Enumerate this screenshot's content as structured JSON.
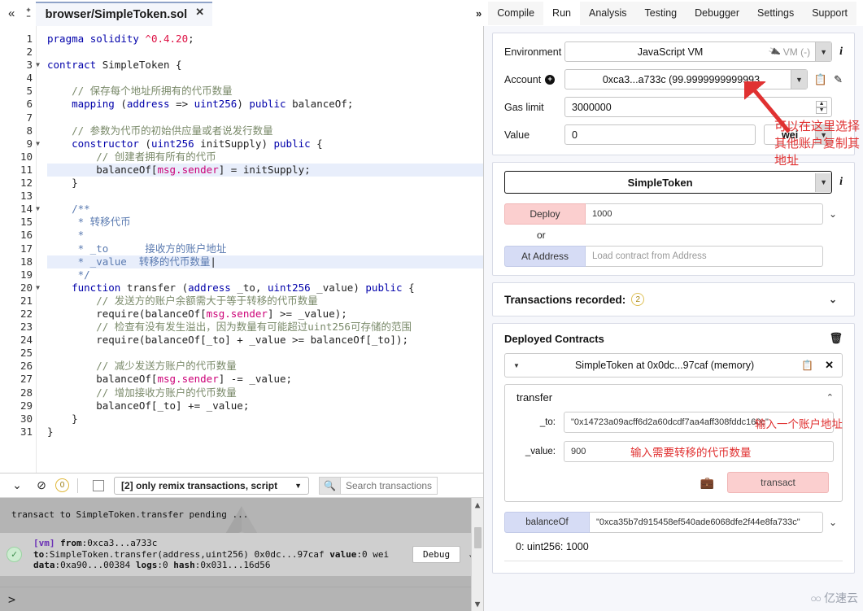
{
  "window": {
    "file_tab": "browser/SimpleToken.sol",
    "collapse_icon": "chevrons-left-icon",
    "zoom_in_icon": "plus-icon",
    "zoom_out_icon": "minus-icon",
    "tab_close_icon": "close-icon"
  },
  "menu": {
    "expand_icon": "chevrons-right-icon",
    "tabs": [
      {
        "label": "Compile",
        "active": false
      },
      {
        "label": "Run",
        "active": true
      },
      {
        "label": "Analysis",
        "active": false
      },
      {
        "label": "Testing",
        "active": false
      },
      {
        "label": "Debugger",
        "active": false
      },
      {
        "label": "Settings",
        "active": false
      },
      {
        "label": "Support",
        "active": false
      }
    ]
  },
  "editor": {
    "lines": [
      {
        "n": 1,
        "fold": false,
        "hl": false,
        "tokens": [
          {
            "t": "pragma ",
            "c": "k"
          },
          {
            "t": "solidity ",
            "c": "k"
          },
          {
            "t": "^0.4.20",
            "c": "num"
          },
          {
            "t": ";",
            "c": "pl"
          }
        ]
      },
      {
        "n": 2,
        "fold": false,
        "hl": false,
        "tokens": []
      },
      {
        "n": 3,
        "fold": true,
        "hl": false,
        "tokens": [
          {
            "t": "contract ",
            "c": "k"
          },
          {
            "t": "SimpleToken ",
            "c": "pl"
          },
          {
            "t": "{",
            "c": "pl"
          }
        ]
      },
      {
        "n": 4,
        "fold": false,
        "hl": false,
        "tokens": []
      },
      {
        "n": 5,
        "fold": false,
        "hl": false,
        "tokens": [
          {
            "t": "    // 保存每个地址所拥有的代币数量",
            "c": "cm"
          }
        ]
      },
      {
        "n": 6,
        "fold": false,
        "hl": false,
        "tokens": [
          {
            "t": "    ",
            "c": "pl"
          },
          {
            "t": "mapping",
            "c": "k"
          },
          {
            "t": " (",
            "c": "pl"
          },
          {
            "t": "address",
            "c": "k"
          },
          {
            "t": " => ",
            "c": "pl"
          },
          {
            "t": "uint256",
            "c": "k"
          },
          {
            "t": ") ",
            "c": "pl"
          },
          {
            "t": "public",
            "c": "k"
          },
          {
            "t": " balanceOf;",
            "c": "pl"
          }
        ]
      },
      {
        "n": 7,
        "fold": false,
        "hl": false,
        "tokens": []
      },
      {
        "n": 8,
        "fold": false,
        "hl": false,
        "tokens": [
          {
            "t": "    // 参数为代币的初始供应量或者说发行数量",
            "c": "cm"
          }
        ]
      },
      {
        "n": 9,
        "fold": true,
        "hl": false,
        "tokens": [
          {
            "t": "    ",
            "c": "pl"
          },
          {
            "t": "constructor",
            "c": "k"
          },
          {
            "t": " (",
            "c": "pl"
          },
          {
            "t": "uint256",
            "c": "k"
          },
          {
            "t": " initSupply) ",
            "c": "pl"
          },
          {
            "t": "public",
            "c": "k"
          },
          {
            "t": " {",
            "c": "pl"
          }
        ]
      },
      {
        "n": 10,
        "fold": false,
        "hl": false,
        "tokens": [
          {
            "t": "        // 创建者拥有所有的代币",
            "c": "cm"
          }
        ]
      },
      {
        "n": 11,
        "fold": false,
        "hl": true,
        "tokens": [
          {
            "t": "        balanceOf[",
            "c": "pl"
          },
          {
            "t": "msg.sender",
            "c": "prop"
          },
          {
            "t": "] = initSupply;",
            "c": "pl"
          }
        ]
      },
      {
        "n": 12,
        "fold": false,
        "hl": false,
        "tokens": [
          {
            "t": "    }",
            "c": "pl"
          }
        ]
      },
      {
        "n": 13,
        "fold": false,
        "hl": false,
        "tokens": []
      },
      {
        "n": 14,
        "fold": true,
        "hl": false,
        "tokens": [
          {
            "t": "    /**",
            "c": "cmblue"
          }
        ]
      },
      {
        "n": 15,
        "fold": false,
        "hl": false,
        "tokens": [
          {
            "t": "     * 转移代币",
            "c": "cmblue"
          }
        ]
      },
      {
        "n": 16,
        "fold": false,
        "hl": false,
        "tokens": [
          {
            "t": "     *",
            "c": "cmblue"
          }
        ]
      },
      {
        "n": 17,
        "fold": false,
        "hl": false,
        "tokens": [
          {
            "t": "     * _to      接收方的账户地址",
            "c": "cmblue"
          }
        ]
      },
      {
        "n": 18,
        "fold": false,
        "hl": true,
        "tokens": [
          {
            "t": "     * _value  转移的代币数量",
            "c": "cmblue"
          },
          {
            "t": "|",
            "c": "pl"
          }
        ]
      },
      {
        "n": 19,
        "fold": false,
        "hl": false,
        "tokens": [
          {
            "t": "     */",
            "c": "cmblue"
          }
        ]
      },
      {
        "n": 20,
        "fold": true,
        "hl": false,
        "tokens": [
          {
            "t": "    ",
            "c": "pl"
          },
          {
            "t": "function",
            "c": "k"
          },
          {
            "t": " transfer (",
            "c": "pl"
          },
          {
            "t": "address",
            "c": "k"
          },
          {
            "t": " _to, ",
            "c": "pl"
          },
          {
            "t": "uint256",
            "c": "k"
          },
          {
            "t": " _value) ",
            "c": "pl"
          },
          {
            "t": "public",
            "c": "k"
          },
          {
            "t": " {",
            "c": "pl"
          }
        ]
      },
      {
        "n": 21,
        "fold": false,
        "hl": false,
        "tokens": [
          {
            "t": "        // 发送方的账户余额需大于等于转移的代币数量",
            "c": "cm"
          }
        ]
      },
      {
        "n": 22,
        "fold": false,
        "hl": false,
        "tokens": [
          {
            "t": "        require(balanceOf[",
            "c": "pl"
          },
          {
            "t": "msg.sender",
            "c": "prop"
          },
          {
            "t": "] >= _value);",
            "c": "pl"
          }
        ]
      },
      {
        "n": 23,
        "fold": false,
        "hl": false,
        "tokens": [
          {
            "t": "        // 检查有没有发生溢出，因为数量有可能超过uint256可存储的范围",
            "c": "cm"
          }
        ]
      },
      {
        "n": 24,
        "fold": false,
        "hl": false,
        "tokens": [
          {
            "t": "        require(balanceOf[_to] + _value >= balanceOf[_to]);",
            "c": "pl"
          }
        ]
      },
      {
        "n": 25,
        "fold": false,
        "hl": false,
        "tokens": []
      },
      {
        "n": 26,
        "fold": false,
        "hl": false,
        "tokens": [
          {
            "t": "        // 减少发送方账户的代币数量",
            "c": "cm"
          }
        ]
      },
      {
        "n": 27,
        "fold": false,
        "hl": false,
        "tokens": [
          {
            "t": "        balanceOf[",
            "c": "pl"
          },
          {
            "t": "msg.sender",
            "c": "prop"
          },
          {
            "t": "] -= _value;",
            "c": "pl"
          }
        ]
      },
      {
        "n": 28,
        "fold": false,
        "hl": false,
        "tokens": [
          {
            "t": "        // 增加接收方账户的代币数量",
            "c": "cm"
          }
        ]
      },
      {
        "n": 29,
        "fold": false,
        "hl": false,
        "tokens": [
          {
            "t": "        balanceOf[_to] += _value;",
            "c": "pl"
          }
        ]
      },
      {
        "n": 30,
        "fold": false,
        "hl": false,
        "tokens": [
          {
            "t": "    }",
            "c": "pl"
          }
        ]
      },
      {
        "n": 31,
        "fold": false,
        "hl": false,
        "tokens": [
          {
            "t": "}",
            "c": "pl"
          }
        ]
      }
    ]
  },
  "terminal": {
    "toolbar": {
      "collapse_icon": "chevrons-down-icon",
      "clear_icon": "no-entry-icon",
      "pending_count": "0",
      "checkbox_checked": false,
      "filter_label": "[2] only remix transactions, script",
      "filter_caret": "caret-down-icon",
      "search_icon": "search-icon",
      "search_placeholder": "Search transactions"
    },
    "log_line": "transact to SimpleToken.transfer pending ...",
    "transaction": {
      "status_icon": "check-circle-icon",
      "vm_tag": "[vm]",
      "from_label": "from",
      "from_value": "0xca3...a733c",
      "to_label": "to",
      "to_value": "SimpleToken.transfer(address,uint256) 0x0dc...97caf",
      "value_label": "value",
      "value_value": "0 wei",
      "data_label": "data",
      "data_value": "0xa90...00384",
      "logs_label": "logs",
      "logs_value": "0",
      "hash_label": "hash",
      "hash_value": "0x031...16d56",
      "debug_button": "Debug",
      "expand_icon": "chevron-down-icon"
    },
    "prompt": ">"
  },
  "run_panel": {
    "environment": {
      "label": "Environment",
      "value": "JavaScript VM",
      "tag": "VM (-)",
      "plug_icon": "plug-icon",
      "info_icon": "info-icon"
    },
    "account": {
      "label": "Account",
      "add_icon": "plus-circle-icon",
      "value": "0xca3...a733c (99.9999999999993",
      "copy_icon": "copy-icon",
      "edit_icon": "edit-icon"
    },
    "gas_limit": {
      "label": "Gas limit",
      "value": "3000000",
      "stepper_icon": "stepper-icon"
    },
    "value": {
      "label": "Value",
      "value": "0",
      "unit": "wei"
    },
    "contract": {
      "selected": "SimpleToken",
      "info_icon": "info-icon"
    },
    "deploy": {
      "button": "Deploy",
      "arg_value": "1000",
      "expand_icon": "chevron-down-icon",
      "or": "or",
      "at_address_button": "At Address",
      "at_address_placeholder": "Load contract from Address"
    },
    "transactions_recorded": {
      "label": "Transactions recorded:",
      "count": "2",
      "expand_icon": "chevron-down-icon"
    },
    "deployed_contracts": {
      "title": "Deployed Contracts",
      "trash_icon": "trash-icon",
      "instance": {
        "toggle_icon": "caret-down-icon",
        "title": "SimpleToken at 0x0dc...97caf (memory)",
        "copy_icon": "copy-icon",
        "close_icon": "close-icon"
      },
      "function": {
        "name": "transfer",
        "collapse_icon": "chevron-up-icon",
        "params": [
          {
            "label": "_to:",
            "value": "\"0x14723a09acff6d2a60dcdf7aa4aff308fddc160c\""
          },
          {
            "label": "_value:",
            "value": "900"
          }
        ],
        "briefcase_icon": "briefcase-icon",
        "transact_button": "transact"
      },
      "getter": {
        "name": "balanceOf",
        "arg_value": "\"0xca35b7d915458ef540ade6068dfe2f44e8fa733c\"",
        "expand_icon": "chevron-down-icon",
        "result": "0: uint256: 1000"
      }
    }
  },
  "annotations": {
    "account_note": "可以在这里选择其他账户复制其地址",
    "to_note": "输入一个账户地址",
    "value_note": "输入需要转移的代币数量",
    "arrow_color": "#e03131"
  },
  "watermark": {
    "text": "亿速云",
    "glyph": "logo-icon"
  }
}
